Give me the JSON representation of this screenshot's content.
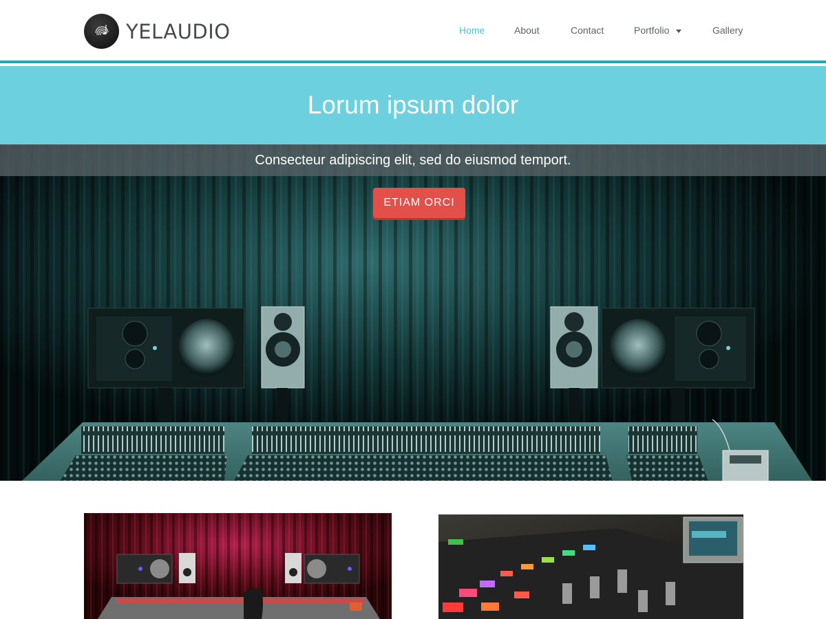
{
  "brand": {
    "name": "YELAUDIO",
    "logo_icon": "fingerprint-music-note-icon"
  },
  "nav": {
    "items": [
      {
        "label": "Home",
        "active": true
      },
      {
        "label": "About",
        "active": false
      },
      {
        "label": "Contact",
        "active": false
      },
      {
        "label": "Portfolio",
        "active": false,
        "has_dropdown": true
      },
      {
        "label": "Gallery",
        "active": false
      }
    ]
  },
  "hero": {
    "title": "Lorum ipsum dolor",
    "subtitle": "Consecteur adipiscing elit, sed do eiusmod temport.",
    "cta_label": "ETIAM ORCI",
    "image": "recording-studio-mixing-console"
  },
  "content": {
    "images": [
      "recording-studio-red-curtain",
      "mixing-console-closeup"
    ]
  },
  "colors": {
    "accent": "#22a7b8",
    "hero_band": "#6cd0de",
    "cta": "#e3504a",
    "nav_active": "#4fc3d4",
    "text": "#5d6468"
  }
}
